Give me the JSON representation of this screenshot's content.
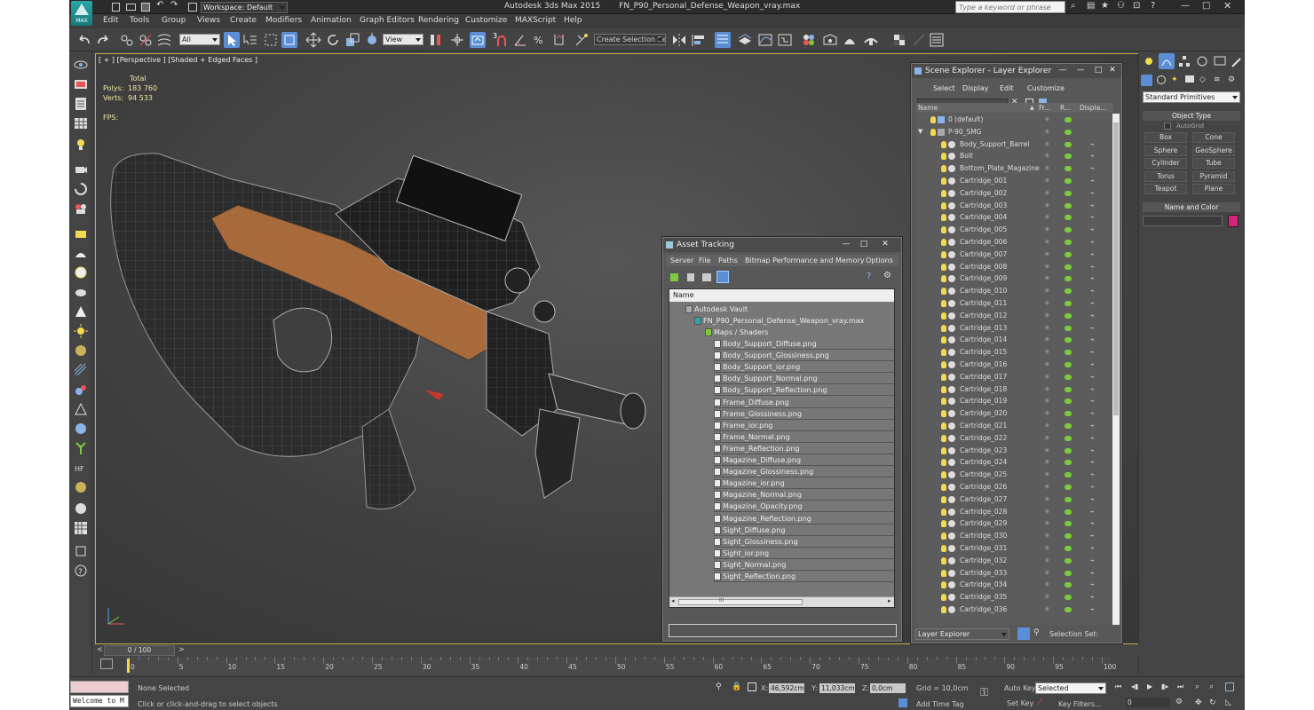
{
  "window": {
    "title": "Autodesk 3ds Max 2015",
    "file_title": "FN_P90_Personal_Defense_Weapon_vray.max",
    "app_badge": "MAX",
    "workspace": "Workspace: Default",
    "search_placeholder": "Type a keyword or phrase"
  },
  "menu": [
    "Edit",
    "Tools",
    "Group",
    "Views",
    "Create",
    "Modifiers",
    "Animation",
    "Graph Editors",
    "Rendering",
    "Customize",
    "MAXScript",
    "Help"
  ],
  "toolbar": {
    "selection_filter": "All",
    "reference_coord": "View",
    "snap_label": "3",
    "selection_set_placeholder": "Create Selection Se"
  },
  "viewport": {
    "label": "[ + ] [Perspective ] [Shaded + Edged Faces ]",
    "stats": {
      "header": "Total",
      "polys_label": "Polys:",
      "polys_value": "183 760",
      "verts_label": "Verts:",
      "verts_value": "94 533",
      "fps_label": "FPS:"
    }
  },
  "asset_tracking": {
    "title": "Asset Tracking",
    "menu": [
      "Server",
      "File",
      "Paths",
      "Bitmap Performance and Memory",
      "Options"
    ],
    "column_name": "Name",
    "vault": "Autodesk Vault",
    "file": "FN_P90_Personal_Defense_Weapon_vray.max",
    "group": "Maps / Shaders",
    "maps": [
      "Body_Support_Diffuse.png",
      "Body_Support_Glossiness.png",
      "Body_Support_ior.png",
      "Body_Support_Normal.png",
      "Body_Support_Reflection.png",
      "Frame_Diffuse.png",
      "Frame_Glossiness.png",
      "Frame_ior.png",
      "Frame_Normal.png",
      "Frame_Reflection.png",
      "Magazine_Diffuse.png",
      "Magazine_Glossiness.png",
      "Magazine_ior.png",
      "Magazine_Normal.png",
      "Magazine_Opacity.png",
      "Magazine_Reflection.png",
      "Sight_Diffuse.png",
      "Sight_Glossiness.png",
      "Sight_ior.png",
      "Sight_Normal.png",
      "Sight_Reflection.png"
    ],
    "scroll_grip": "III"
  },
  "scene_explorer": {
    "title": "Scene Explorer - Layer Explorer",
    "menu": [
      "Select",
      "Display",
      "Edit",
      "Customize"
    ],
    "columns": [
      "Name",
      "Fr...",
      "R...",
      "Displa..."
    ],
    "layers": [
      "0 (default)",
      "P-90_SMG"
    ],
    "objects": [
      "Body_Support_Barrel",
      "Bolt",
      "Bottom_Plate_Magazine",
      "Cartridge_001",
      "Cartridge_002",
      "Cartridge_003",
      "Cartridge_004",
      "Cartridge_005",
      "Cartridge_006",
      "Cartridge_007",
      "Cartridge_008",
      "Cartridge_009",
      "Cartridge_010",
      "Cartridge_011",
      "Cartridge_012",
      "Cartridge_013",
      "Cartridge_014",
      "Cartridge_015",
      "Cartridge_016",
      "Cartridge_017",
      "Cartridge_018",
      "Cartridge_019",
      "Cartridge_020",
      "Cartridge_021",
      "Cartridge_022",
      "Cartridge_023",
      "Cartridge_024",
      "Cartridge_025",
      "Cartridge_026",
      "Cartridge_027",
      "Cartridge_028",
      "Cartridge_029",
      "Cartridge_030",
      "Cartridge_031",
      "Cartridge_032",
      "Cartridge_033",
      "Cartridge_034",
      "Cartridge_035",
      "Cartridge_036"
    ],
    "footer_dropdown": "Layer Explorer",
    "selection_set_label": "Selection Set:"
  },
  "command_panel": {
    "category": "Standard Primitives",
    "object_type": "Object Type",
    "autogrid": "AutoGrid",
    "buttons": [
      "Box",
      "Cone",
      "Sphere",
      "GeoSphere",
      "Cylinder",
      "Tube",
      "Torus",
      "Pyramid",
      "Teapot",
      "Plane"
    ],
    "name_and_color": "Name and Color",
    "color": "#d6237a"
  },
  "timeline": {
    "frame": "0 / 100",
    "ticks": [
      "0",
      "5",
      "10",
      "15",
      "20",
      "25",
      "30",
      "35",
      "40",
      "45",
      "50",
      "55",
      "60",
      "65",
      "70",
      "75",
      "80",
      "85",
      "90",
      "95",
      "100"
    ]
  },
  "status": {
    "maxscript": "Welcome to M",
    "selection": "None Selected",
    "prompt": "Click or click-and-drag to select objects",
    "x_label": "X:",
    "x_value": "46,592cm",
    "y_label": "Y:",
    "y_value": "11,033cm",
    "z_label": "Z:",
    "z_value": "0,0cm",
    "grid": "Grid = 10,0cm",
    "add_time_tag": "Add Time Tag",
    "auto_key": "Auto Key",
    "set_key": "Set Key",
    "key_mode": "Selected",
    "key_filters": "Key Filters...",
    "frame_value": "0"
  }
}
